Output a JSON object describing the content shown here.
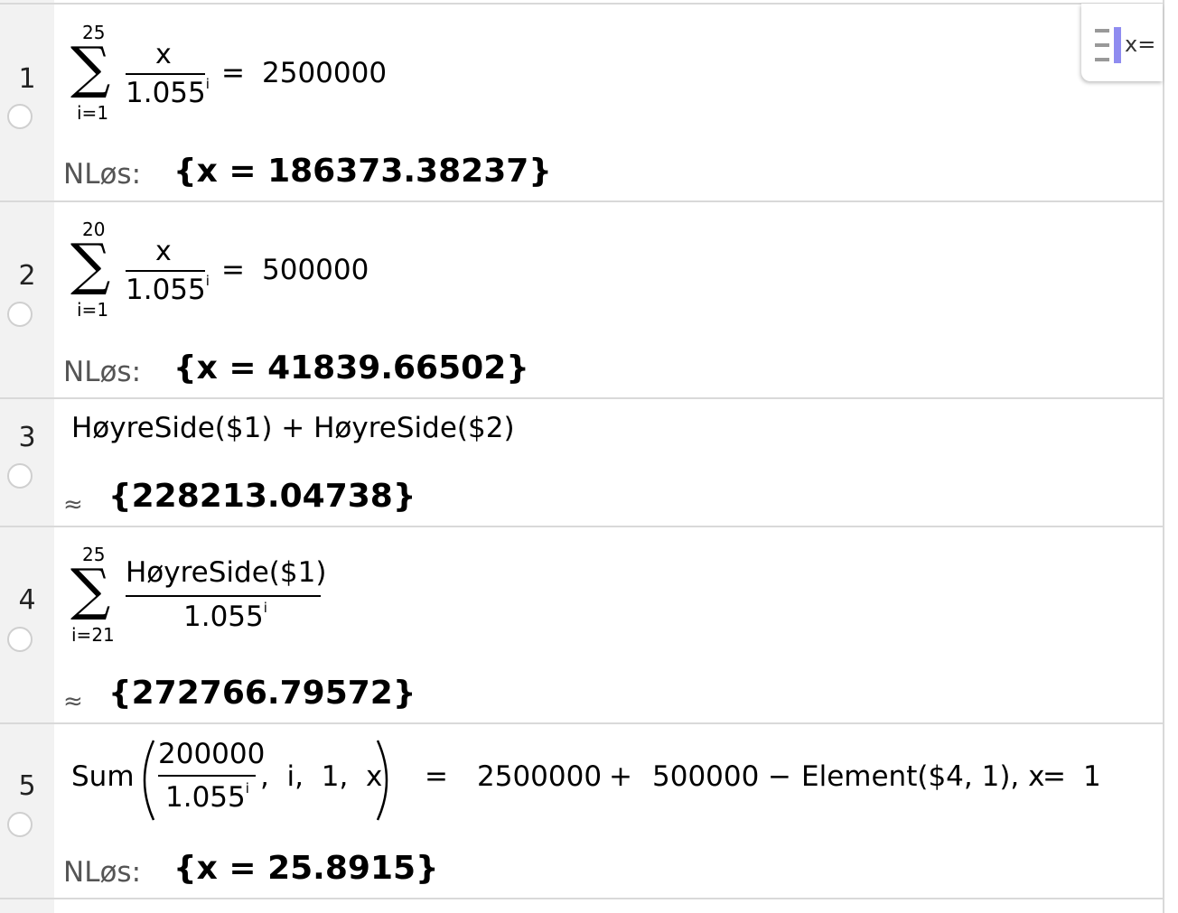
{
  "algebra_toggle": {
    "label": "x=",
    "icon": "algebra-view-toggle-icon"
  },
  "rows": [
    {
      "number": "1",
      "sum_upper": "25",
      "sum_lower": "i=1",
      "numerator": "x",
      "denominator_base": "1.055",
      "denominator_exp": "i",
      "equals": "=",
      "rhs": "2500000",
      "output_label": "NLøs:",
      "output_value": "{x = 186373.38237}"
    },
    {
      "number": "2",
      "sum_upper": "20",
      "sum_lower": "i=1",
      "numerator": "x",
      "denominator_base": "1.055",
      "denominator_exp": "i",
      "equals": "=",
      "rhs": "500000",
      "output_label": "NLøs:",
      "output_value": "{x = 41839.66502}"
    },
    {
      "number": "3",
      "input": "HøyreSide($1) + HøyreSide($2)",
      "output_label": "≈",
      "output_value": "{228213.04738}"
    },
    {
      "number": "4",
      "sum_upper": "25",
      "sum_lower": "i=21",
      "numerator": "HøyreSide($1)",
      "denominator_base": "1.055",
      "denominator_exp": "i",
      "output_label": "≈",
      "output_value": "{272766.79572}"
    },
    {
      "number": "5",
      "func": "Sum",
      "numerator": "200000",
      "denominator_base": "1.055",
      "denominator_exp": "i",
      "args": ",  i,  1,  x",
      "equals": "=",
      "rhs_a": "2500000",
      "plus": "+",
      "rhs_b": "500000",
      "minus": "−",
      "rhs_c": "Element($4, 1), x",
      "equals2": "=",
      "rhs_d": "1",
      "output_label": "NLøs:",
      "output_value": "{x = 25.8915}"
    }
  ]
}
